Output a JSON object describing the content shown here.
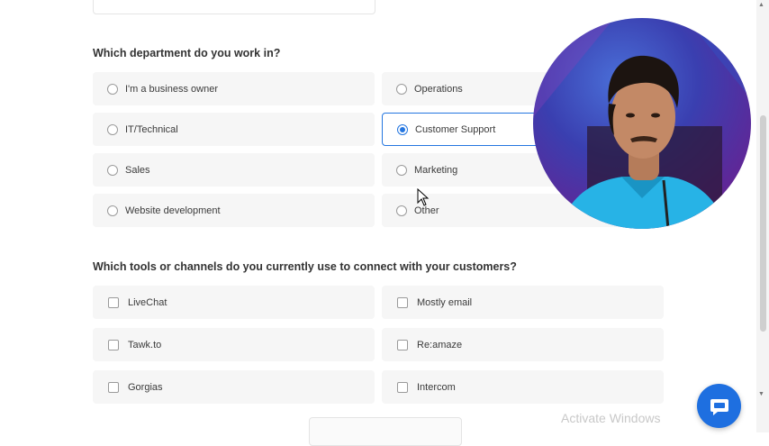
{
  "department": {
    "question": "Which department do you work in?",
    "options": [
      {
        "label": "I'm a business owner",
        "selected": false
      },
      {
        "label": "Operations",
        "selected": false
      },
      {
        "label": "IT/Technical",
        "selected": false
      },
      {
        "label": "Customer Support",
        "selected": true
      },
      {
        "label": "Sales",
        "selected": false
      },
      {
        "label": "Marketing",
        "selected": false
      },
      {
        "label": "Website development",
        "selected": false
      },
      {
        "label": "Other",
        "selected": false
      }
    ]
  },
  "tools": {
    "question": "Which tools or channels do you currently use to connect with your customers?",
    "options": [
      {
        "label": "LiveChat",
        "checked": false
      },
      {
        "label": "Mostly email",
        "checked": false
      },
      {
        "label": "Tawk.to",
        "checked": false
      },
      {
        "label": "Re:amaze",
        "checked": false
      },
      {
        "label": "Gorgias",
        "checked": false
      },
      {
        "label": "Intercom",
        "checked": false
      }
    ]
  },
  "watermark": "Activate Windows",
  "colors": {
    "accent": "#2476e0",
    "chat_button": "#1e6fe0"
  },
  "icons": {
    "chat_button": "chat-bubble-icon",
    "cursor": "mouse-pointer-icon"
  }
}
